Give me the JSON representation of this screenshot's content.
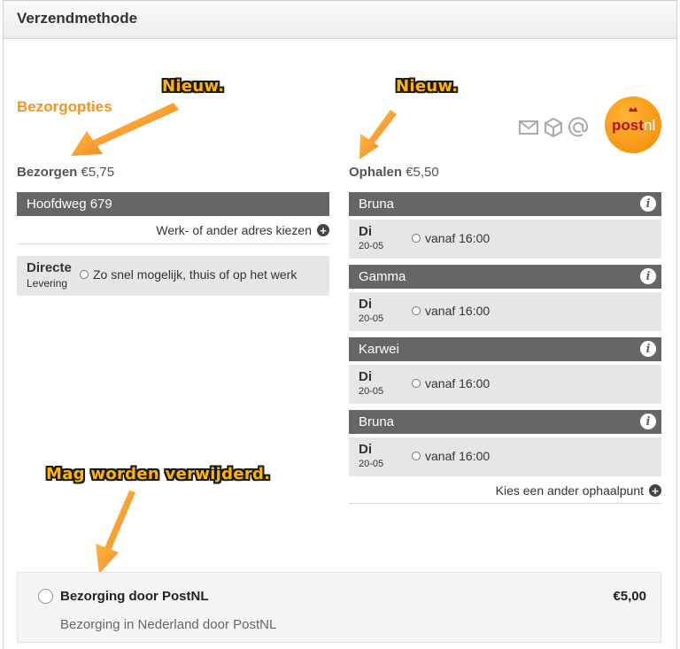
{
  "header": {
    "title": "Verzendmethode"
  },
  "section_title": "Bezorgopties",
  "annotations": {
    "new_left": "Nieuw.",
    "new_right": "Nieuw.",
    "removable": "Mag worden verwijderd."
  },
  "delivery_col": {
    "label_bold": "Bezorgen",
    "price": "€5,75",
    "address": "Hoofdweg 679",
    "change_address_link": "Werk- of ander adres kiezen",
    "option_title": "Directe",
    "option_subtitle": "Levering",
    "option_text": "Zo snel mogelijk, thuis of op het werk"
  },
  "pickup_col": {
    "label_bold": "Ophalen",
    "price": "€5,50",
    "stores": [
      {
        "name": "Bruna",
        "day": "Di",
        "date": "20-05",
        "time": "vanaf 16:00"
      },
      {
        "name": "Gamma",
        "day": "Di",
        "date": "20-05",
        "time": "vanaf 16:00"
      },
      {
        "name": "Karwei",
        "day": "Di",
        "date": "20-05",
        "time": "vanaf 16:00"
      },
      {
        "name": "Bruna",
        "day": "Di",
        "date": "20-05",
        "time": "vanaf 16:00"
      }
    ],
    "other_pickup_link": "Kies een ander ophaalpunt"
  },
  "logo": {
    "text_post": "post",
    "text_nl": "nl",
    "color": "#f28a00"
  },
  "icons": [
    "envelope-icon",
    "package-icon",
    "at-icon",
    "info-icon",
    "plus-icon"
  ],
  "postnl_option": {
    "title": "Bezorging door PostNL",
    "price": "€5,00",
    "description": "Bezorging in Nederland door PostNL"
  },
  "colors": {
    "accent": "#f7931e",
    "bar": "#666666",
    "option_bg": "#e6e6e6"
  }
}
